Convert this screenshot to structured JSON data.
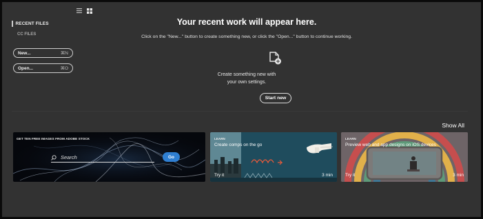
{
  "view_toggle": {
    "list_icon": "list-view-icon",
    "grid_icon": "grid-view-icon"
  },
  "sidebar": {
    "recent_files": "RECENT FILES",
    "cc_files": "CC FILES",
    "new_button": {
      "label": "New...",
      "shortcut": "⌘N"
    },
    "open_button": {
      "label": "Open...",
      "shortcut": "⌘O"
    }
  },
  "main": {
    "headline": "Your recent work will appear here.",
    "subline": "Click on the \"New...\" button to create something new, or click the \"Open...\" button to continue working.",
    "create_line1": "Create something new with",
    "create_line2": "your own settings.",
    "start_button": "Start new"
  },
  "show_all": "Show All",
  "cards": {
    "stock": {
      "title": "GET TEN FREE IMAGES FROM ADOBE STOCK",
      "search_placeholder": "Search",
      "go_label": "Go"
    },
    "comps": {
      "tag": "LEARN",
      "title": "Create comps on the go",
      "action": "Try it",
      "duration": "3 min"
    },
    "preview": {
      "tag": "LEARN",
      "title": "Preview web and app designs on iOS devices",
      "action": "Try it",
      "duration": "3 min"
    }
  },
  "colors": {
    "background": "#323232",
    "border": "#0a0a0a",
    "go_button": "#2f7fd2",
    "comps_card": "#1d4b5c",
    "preview_card": "#6c6466"
  }
}
